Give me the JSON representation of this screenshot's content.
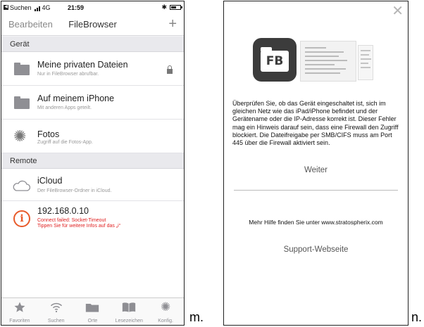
{
  "left_phone": {
    "status_bar": {
      "back_label": "Suchen",
      "network": "4G",
      "time": "21:59",
      "bluetooth": "✱"
    },
    "nav": {
      "edit_label": "Bearbeiten",
      "title": "FileBrowser",
      "add_label": "+"
    },
    "sections": {
      "device_header": "Gerät",
      "remote_header": "Remote"
    },
    "rows": {
      "private": {
        "title": "Meine privaten Dateien",
        "subtitle": "Nur in FileBrowser abrufbar.",
        "icon": "folder-icon"
      },
      "iphone": {
        "title": "Auf meinem iPhone",
        "subtitle": "Mit anderen Apps geteilt.",
        "icon": "folder-icon"
      },
      "photos": {
        "title": "Fotos",
        "subtitle": "Zugriff auf die Fotos-App.",
        "icon": "gear-icon"
      },
      "icloud": {
        "title": "iCloud",
        "subtitle": "Der FileBrowser-Ordner in iCloud.",
        "icon": "cloud-icon"
      },
      "server": {
        "title": "192.168.0.10",
        "error_line1": "Connect failed: Socket-Timeout",
        "error_line2": "Tippen Sie für weitere Infos auf das „i“",
        "icon": "error-icon"
      }
    },
    "tabs": [
      {
        "label": "Favoriten",
        "icon": "star-icon"
      },
      {
        "label": "Suchen",
        "icon": "wifi-icon"
      },
      {
        "label": "Orte",
        "icon": "folder-icon"
      },
      {
        "label": "Lesezeichen",
        "icon": "book-icon"
      },
      {
        "label": "Konfig.",
        "icon": "gear-icon"
      }
    ]
  },
  "captions": {
    "left": "m.",
    "right": "n."
  },
  "right_phone": {
    "close_label": "✕",
    "logo_text": "FB",
    "message": "Überprüfen Sie, ob das Gerät eingeschaltet ist, sich im gleichen Netz wie das iPad/iPhone befindet und der Gerätename oder die IP-Adresse korrekt ist. Dieser Fehler mag ein Hinweis darauf sein, dass eine Firewall den Zugriff blockiert. Die Dateifreigabe per SMB/CIFS muss am Port 445 über die Firewall aktiviert sein.",
    "continue_label": "Weiter",
    "help_text": "Mehr Hilfe finden Sie unter www.stratospherix.com",
    "support_label": "Support-Webseite"
  },
  "colors": {
    "error_red": "#e02020",
    "error_icon": "#e85a2a",
    "icon_gray": "#8e8e93"
  }
}
